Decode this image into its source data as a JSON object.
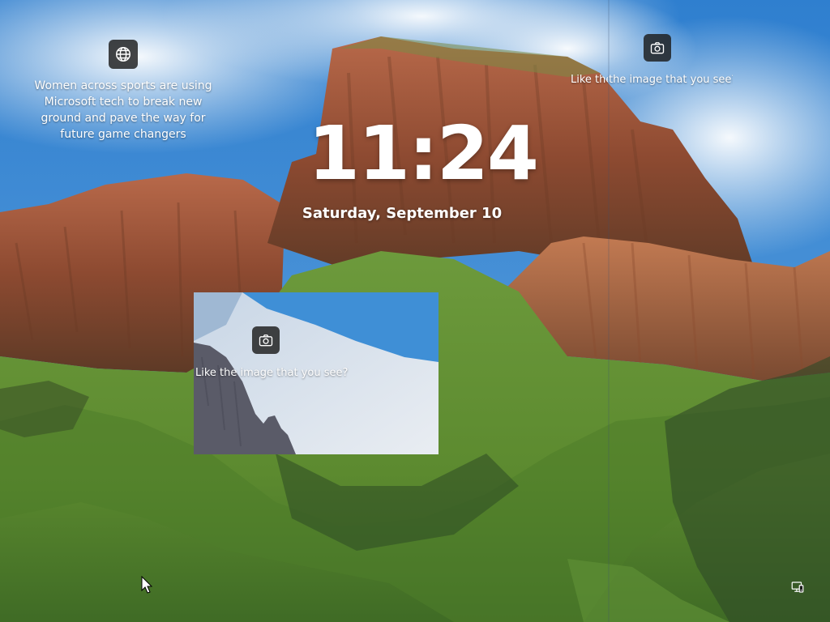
{
  "lock_screen": {
    "time": "11:24",
    "date": "Saturday, September 10"
  },
  "news_widget": {
    "icon": "globe-icon",
    "text": "Women across sports are using Microsoft tech to break new ground and pave the way for future game changers"
  },
  "spotlight_widget": {
    "icon": "camera-icon",
    "clipped_prefix": "Like the",
    "text": "the image that you see?"
  },
  "spotlight_panel": {
    "icon": "camera-icon",
    "text": "Like the image that you see?"
  },
  "status_bar": {
    "network_icon": "network-icon"
  },
  "colors": {
    "text": "#ffffff",
    "button_bg": "#1c1c1c",
    "sky": "#3f8fd6",
    "cliff": "#a5563a",
    "grass": "#6f9a3a"
  }
}
